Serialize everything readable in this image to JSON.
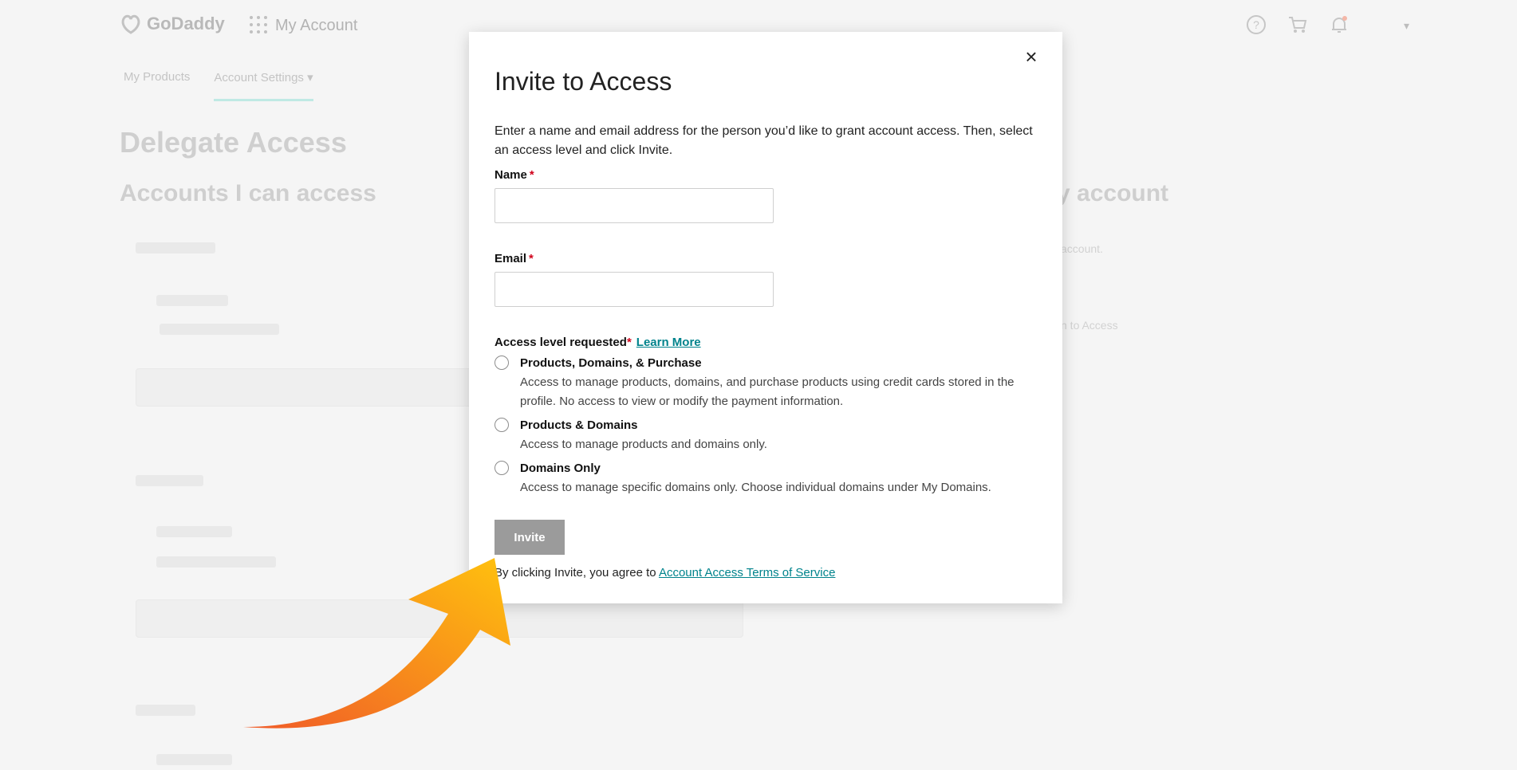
{
  "background": {
    "brand": "GoDaddy",
    "app_title": "My Account",
    "nav": {
      "my_products": "My Products",
      "account_settings": "Account Settings"
    },
    "page_title": "Delegate Access",
    "left_heading": "Accounts I can access",
    "right_heading": "y account",
    "right_snippet_1": "account.",
    "right_snippet_2": "n to Access"
  },
  "modal": {
    "title": "Invite to Access",
    "close_label": "×",
    "intro": "Enter a name and email address for the person you’d like to grant account access. Then, select an access level and click Invite.",
    "name_label": "Name",
    "email_label": "Email",
    "required_mark": "*",
    "name_value": "",
    "email_value": "",
    "access_label": "Access level requested",
    "learn_more": "Learn More",
    "options": [
      {
        "title": "Products, Domains, & Purchase",
        "desc": "Access to manage products, domains, and purchase products using credit cards stored in the profile. No access to view or modify the payment information."
      },
      {
        "title": "Products & Domains",
        "desc": "Access to manage products and domains only."
      },
      {
        "title": "Domains Only",
        "desc": "Access to manage specific domains only. Choose individual domains under My Domains."
      }
    ],
    "invite_button": "Invite",
    "terms_prefix": "By clicking Invite, you agree to",
    "terms_link": "Account Access Terms of Service"
  },
  "colors": {
    "link": "#00838c",
    "required": "#d0021b",
    "button_disabled": "#9b9b9b",
    "arrow_start": "#f05a28",
    "arrow_end": "#ffc20e"
  }
}
